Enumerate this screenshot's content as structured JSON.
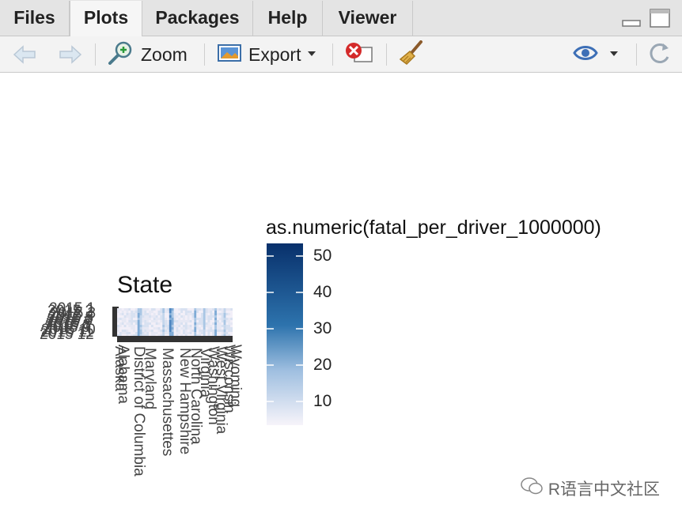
{
  "tabs": [
    {
      "label": "Files"
    },
    {
      "label": "Plots"
    },
    {
      "label": "Packages"
    },
    {
      "label": "Help"
    },
    {
      "label": "Viewer"
    }
  ],
  "toolbar": {
    "zoom_label": "Zoom",
    "export_label": "Export"
  },
  "plot": {
    "y_title": "State",
    "legend_title": "as.numeric(fatal_per_driver_1000000)",
    "legend_ticks": [
      "50",
      "40",
      "30",
      "20",
      "10"
    ],
    "y_labels": [
      "2015 1",
      "2015 2",
      "2015 3",
      "2015 4",
      "2015 5",
      "2015 6",
      "2015 7",
      "2015 8",
      "2015 9",
      "2015 10",
      "2015 11",
      "2015 12"
    ],
    "x_labels_visible": [
      "Alabama",
      "Alaska",
      "District of Columbia",
      "Maryland",
      "Massachusettes",
      "New Hampshire",
      "North Carolina",
      "Virginia",
      "Washington",
      "West Virginia",
      "Wisconsin",
      "Wyoming"
    ]
  },
  "watermark": {
    "text": "R语言中文社区"
  },
  "colors": {
    "legend_high": "#08306b",
    "legend_low": "#f7f4fa",
    "active_tab": "#f6f6f6"
  }
}
